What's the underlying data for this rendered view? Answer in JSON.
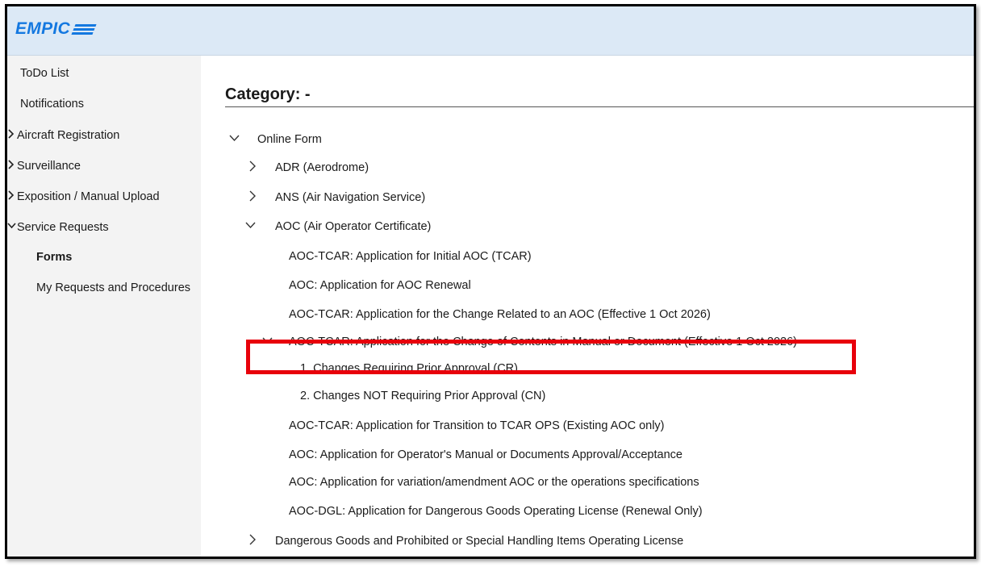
{
  "app": {
    "logo_text": "EMPIC"
  },
  "sidebar": {
    "items": [
      {
        "label": "ToDo List",
        "expander": ""
      },
      {
        "label": "Notifications",
        "expander": ""
      },
      {
        "label": "Aircraft Registration",
        "expander": "chevron-right"
      },
      {
        "label": "Surveillance",
        "expander": "chevron-right"
      },
      {
        "label": "Exposition / Manual Upload",
        "expander": "chevron-right"
      },
      {
        "label": "Service Requests",
        "expander": "chevron-down"
      },
      {
        "label": "Forms",
        "expander": "",
        "selected": true
      },
      {
        "label": "My Requests and Procedures",
        "expander": ""
      }
    ]
  },
  "main": {
    "category_title": "Category: -",
    "tree": [
      {
        "label": "Online Form",
        "expander": "chevron-down"
      },
      {
        "label": "ADR (Aerodrome)",
        "expander": "chevron-right"
      },
      {
        "label": "ANS (Air Navigation Service)",
        "expander": "chevron-right"
      },
      {
        "label": "AOC (Air Operator Certificate)",
        "expander": "chevron-down"
      },
      {
        "label": "AOC-TCAR: Application for Initial AOC (TCAR)",
        "expander": ""
      },
      {
        "label": "AOC: Application for AOC Renewal",
        "expander": ""
      },
      {
        "label": "AOC-TCAR: Application for the Change Related to an AOC (Effective 1 Oct 2026)",
        "expander": ""
      },
      {
        "label": "AOC-TCAR: Application for the Change of Contents in Manual or Document (Effective 1 Oct 2026)",
        "expander": "chevron-down"
      },
      {
        "label": "1. Changes Requiring Prior Approval (CR)",
        "expander": "",
        "highlighted": true
      },
      {
        "label": "2. Changes NOT Requiring Prior Approval (CN)",
        "expander": ""
      },
      {
        "label": "AOC-TCAR: Application for Transition to TCAR OPS (Existing AOC only)",
        "expander": ""
      },
      {
        "label": "AOC: Application for Operator's Manual or Documents Approval/Acceptance",
        "expander": ""
      },
      {
        "label": "AOC: Application for variation/amendment AOC or the operations specifications",
        "expander": ""
      },
      {
        "label": "AOC-DGL: Application for Dangerous Goods Operating License (Renewal Only)",
        "expander": ""
      },
      {
        "label": "Dangerous Goods and Prohibited or Special Handling Items Operating License",
        "expander": "chevron-right"
      }
    ]
  },
  "colors": {
    "accent": "#1478e0",
    "header_bg": "#dce9f6",
    "sidebar_bg": "#f3f3f3",
    "highlight": "#e8000b"
  }
}
